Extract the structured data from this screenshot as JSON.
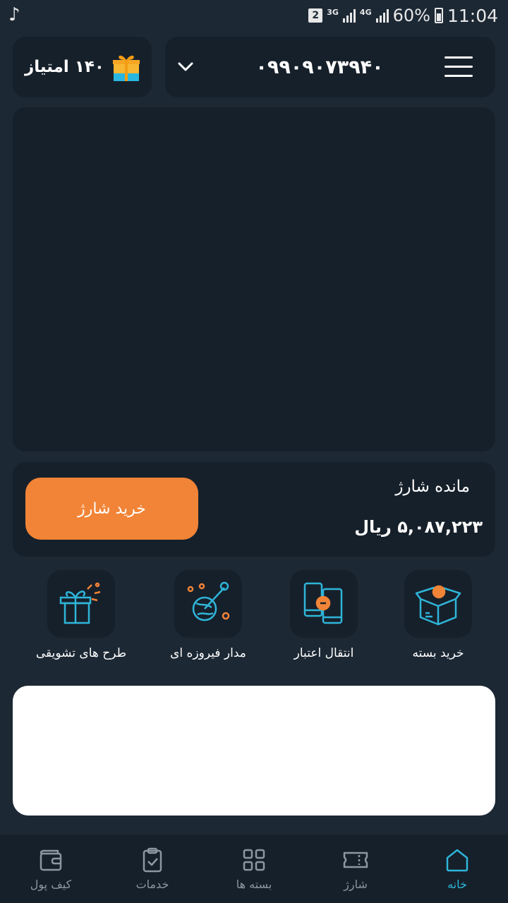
{
  "status_bar": {
    "sim_slot": "2",
    "network_1": "3G",
    "network_2": "4G",
    "battery_percent": "60%",
    "time": "11:04"
  },
  "header": {
    "points_text": "۱۴۰ امتیاز",
    "phone_number": "۰۹۹۰۹۰۷۳۹۴۰"
  },
  "balance": {
    "label": "مانده شارژ",
    "value": "۵,۰۸۷,۲۲۳ ریال",
    "buy_button": "خرید شارژ"
  },
  "quick_actions": [
    {
      "label": "خرید بسته",
      "icon": "open-box-icon"
    },
    {
      "label": "انتقال اعتبار",
      "icon": "phone-transfer-icon"
    },
    {
      "label": "مدار فیروزه ای",
      "icon": "globe-orbit-icon"
    },
    {
      "label": "طرح های تشویقی",
      "icon": "gift-icon"
    }
  ],
  "bottom_nav": [
    {
      "label": "خانه",
      "icon": "home-icon",
      "active": true
    },
    {
      "label": "شارژ",
      "icon": "ticket-icon",
      "active": false
    },
    {
      "label": "بسته ها",
      "icon": "grid-icon",
      "active": false
    },
    {
      "label": "خدمات",
      "icon": "clipboard-check-icon",
      "active": false
    },
    {
      "label": "کیف پول",
      "icon": "wallet-icon",
      "active": false
    }
  ],
  "colors": {
    "background": "#1c2834",
    "card": "#16202b",
    "accent_orange": "#f28437",
    "accent_cyan": "#2fb5d9"
  }
}
